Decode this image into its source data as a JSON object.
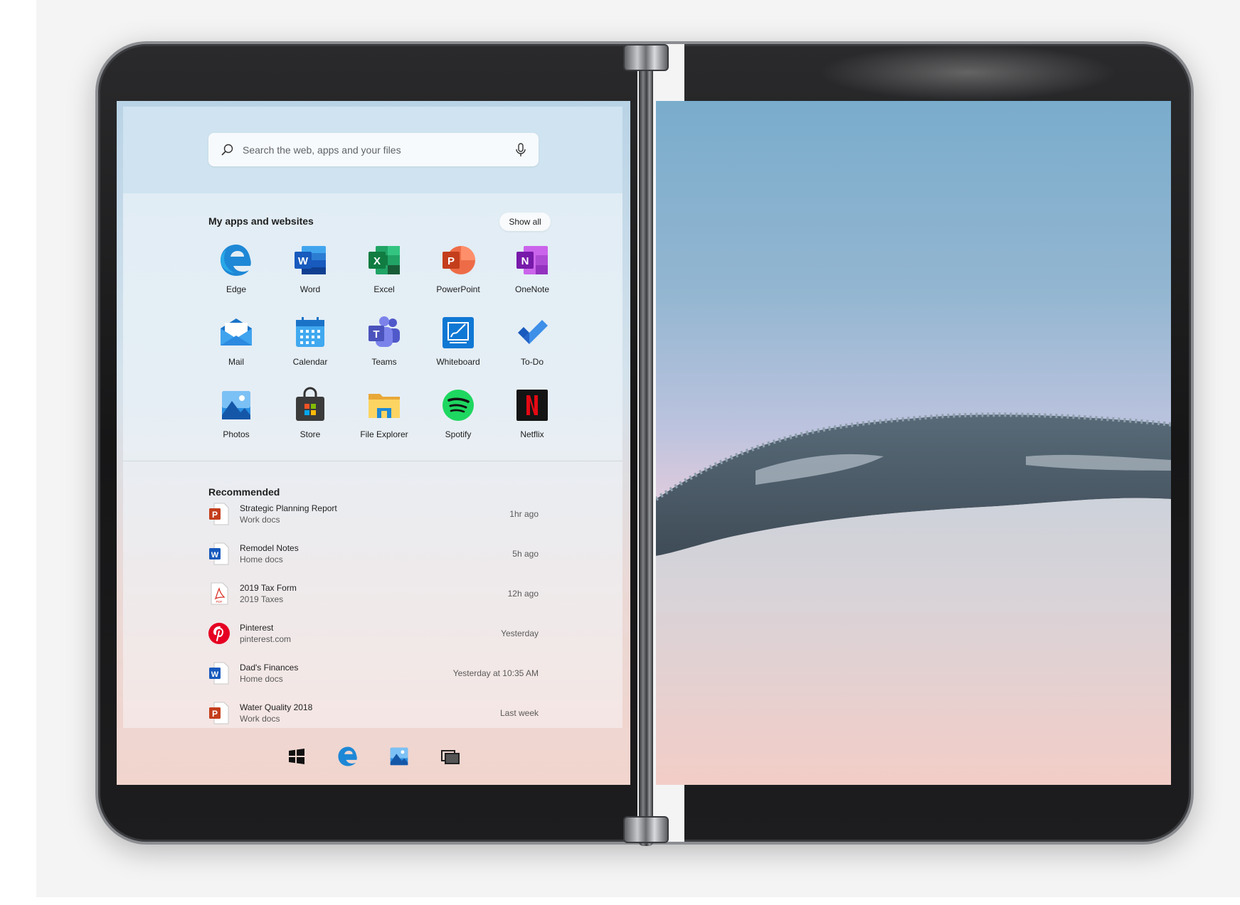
{
  "search": {
    "placeholder": "Search the web, apps and your files"
  },
  "apps_section": {
    "title": "My apps and websites",
    "show_all": "Show all"
  },
  "apps": [
    {
      "label": "Edge",
      "icon": "edge-icon"
    },
    {
      "label": "Word",
      "icon": "word-icon"
    },
    {
      "label": "Excel",
      "icon": "excel-icon"
    },
    {
      "label": "PowerPoint",
      "icon": "powerpoint-icon"
    },
    {
      "label": "OneNote",
      "icon": "onenote-icon"
    },
    {
      "label": "Mail",
      "icon": "mail-icon"
    },
    {
      "label": "Calendar",
      "icon": "calendar-icon"
    },
    {
      "label": "Teams",
      "icon": "teams-icon"
    },
    {
      "label": "Whiteboard",
      "icon": "whiteboard-icon"
    },
    {
      "label": "To-Do",
      "icon": "todo-icon"
    },
    {
      "label": "Photos",
      "icon": "photos-icon"
    },
    {
      "label": "Store",
      "icon": "store-icon"
    },
    {
      "label": "File Explorer",
      "icon": "file-explorer-icon"
    },
    {
      "label": "Spotify",
      "icon": "spotify-icon"
    },
    {
      "label": "Netflix",
      "icon": "netflix-icon"
    }
  ],
  "recommended": {
    "title": "Recommended",
    "items": [
      {
        "name": "Strategic Planning Report",
        "sub": "Work docs",
        "time": "1hr ago",
        "icon": "powerpoint-file-icon"
      },
      {
        "name": "Remodel Notes",
        "sub": "Home docs",
        "time": "5h ago",
        "icon": "word-file-icon"
      },
      {
        "name": "2019 Tax Form",
        "sub": "2019 Taxes",
        "time": "12h ago",
        "icon": "pdf-file-icon"
      },
      {
        "name": "Pinterest",
        "sub": "pinterest.com",
        "time": "Yesterday",
        "icon": "pinterest-icon"
      },
      {
        "name": "Dad's Finances",
        "sub": "Home docs",
        "time": "Yesterday at 10:35 AM",
        "icon": "word-file-icon"
      },
      {
        "name": "Water Quality 2018",
        "sub": "Work docs",
        "time": "Last week",
        "icon": "powerpoint-file-icon"
      }
    ]
  },
  "taskbar": [
    "windows-start-icon",
    "edge-icon",
    "photos-icon",
    "task-view-icon"
  ]
}
